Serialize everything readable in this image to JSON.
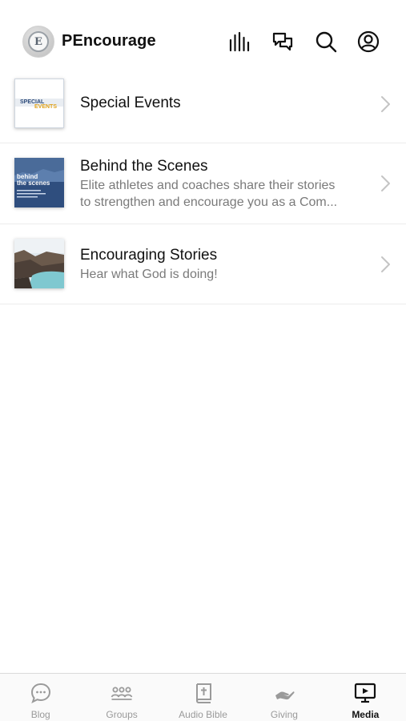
{
  "header": {
    "title": "PEncourage",
    "logo_letter": "E",
    "icons": [
      "audio-bars-icon",
      "chat-icon",
      "search-icon",
      "profile-icon"
    ]
  },
  "list": {
    "items": [
      {
        "title": "Special Events",
        "subtitle_lines": [],
        "thumb_text": "SPECIAL EVENTS"
      },
      {
        "title": "Behind the Scenes",
        "subtitle_lines": [
          "Elite athletes and coaches share their stories",
          "to strengthen and encourage you as a Com..."
        ],
        "thumb_text": "behind the scenes"
      },
      {
        "title": "Encouraging Stories",
        "subtitle_lines": [
          "Hear what God is doing!"
        ],
        "thumb_text": ""
      }
    ]
  },
  "tabbar": {
    "tabs": [
      {
        "label": "Blog",
        "icon": "chat-bubble-icon",
        "active": false
      },
      {
        "label": "Groups",
        "icon": "groups-icon",
        "active": false
      },
      {
        "label": "Audio Bible",
        "icon": "bible-icon",
        "active": false
      },
      {
        "label": "Giving",
        "icon": "giving-hand-icon",
        "active": false
      },
      {
        "label": "Media",
        "icon": "media-play-icon",
        "active": true
      }
    ]
  },
  "colors": {
    "text_primary": "#111111",
    "text_secondary": "#7a7a7a",
    "tab_inactive": "#9a9a9a",
    "divider": "#ececec"
  }
}
